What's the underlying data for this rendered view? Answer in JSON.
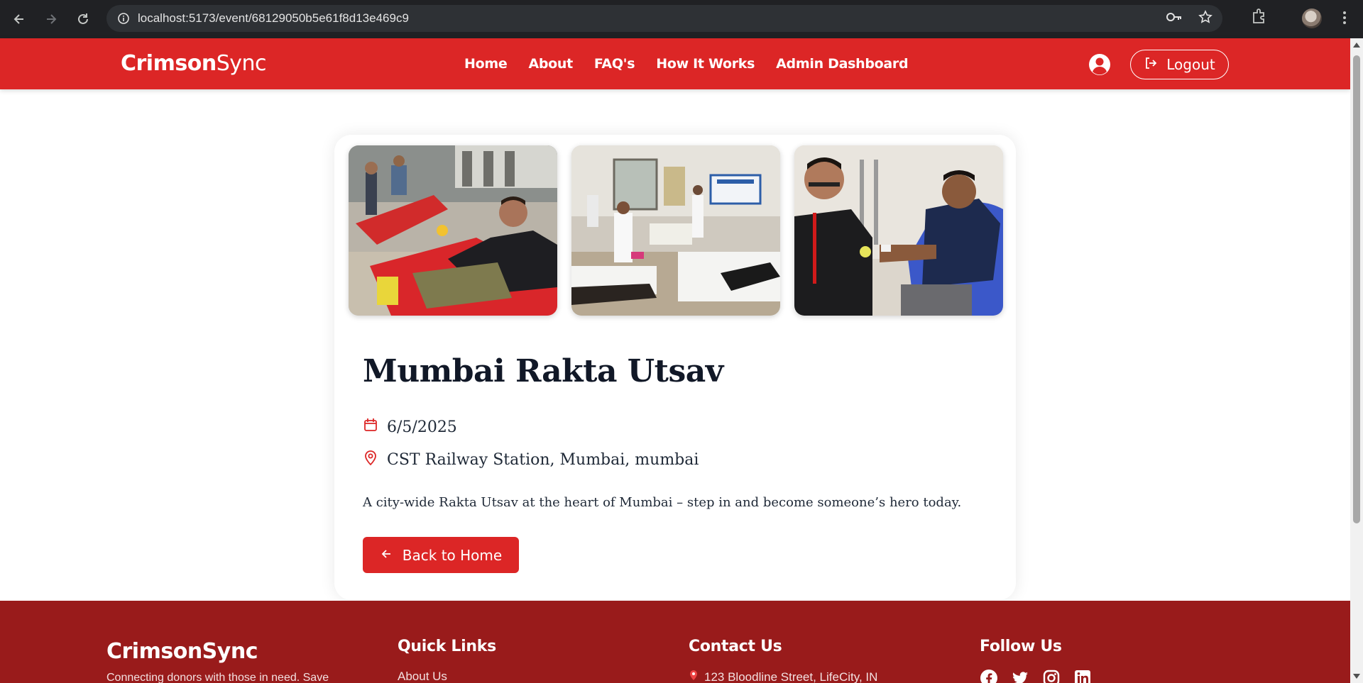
{
  "browser": {
    "url": "localhost:5173/event/68129050b5e61f8d13e469c9",
    "icons": [
      "back-arrow-icon",
      "forward-arrow-icon",
      "reload-icon",
      "site-info-icon",
      "password-key-icon",
      "bookmark-star-icon",
      "extensions-icon",
      "profile-avatar",
      "more-menu-icon"
    ]
  },
  "header": {
    "brand_bold": "Crimson",
    "brand_light": "Sync",
    "nav": [
      "Home",
      "About",
      "FAQ's",
      "How It Works",
      "Admin Dashboard"
    ],
    "logout_label": "Logout"
  },
  "event": {
    "title": "Mumbai Rakta Utsav",
    "date": "6/5/2025",
    "location": "CST Railway Station, Mumbai, mumbai",
    "description": "A city-wide Rakta Utsav at the heart of Mumbai – step in and become someone’s hero today.",
    "back_label": "Back to Home",
    "photos": [
      "blood-donation-hall-photo",
      "donation-camp-classroom-photo",
      "donor-with-volunteer-photo"
    ]
  },
  "footer": {
    "brand": "CrimsonSync",
    "tagline": "Connecting donors with those in need. Save",
    "quick_links_title": "Quick Links",
    "quick_link_1": "About Us",
    "contact_title": "Contact Us",
    "address": "123 Bloodline Street, LifeCity, IN",
    "follow_title": "Follow Us",
    "social": [
      "facebook-icon",
      "twitter-icon",
      "instagram-icon",
      "linkedin-icon"
    ]
  },
  "colors": {
    "primary_red": "#dc2626",
    "footer_red": "#991b1b",
    "title_dark": "#111827"
  }
}
